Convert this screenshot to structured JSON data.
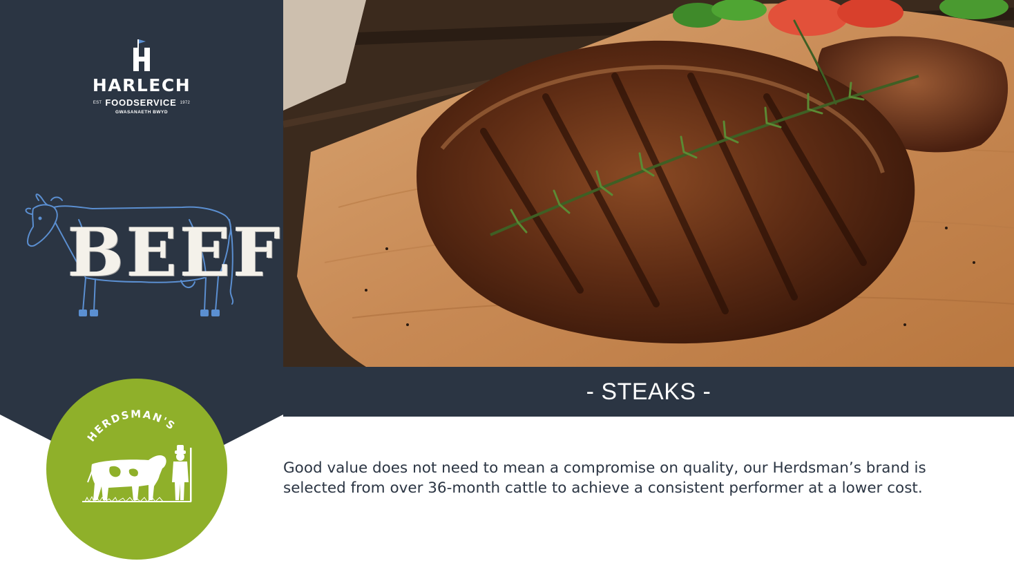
{
  "brand": {
    "name": "HARLECH",
    "est": "EST",
    "division": "FOODSERVICE",
    "year": "1972",
    "welsh": "GWASANAETH BWYD"
  },
  "category": {
    "word": "BEEF"
  },
  "badge": {
    "name": "HERDSMAN'S"
  },
  "hero": {
    "image": "grilled-ribeye-steak-photo"
  },
  "section": {
    "title": "- STEAKS -"
  },
  "description": "Good value does not need to mean a compromise on quality, our Herdsman’s brand is selected from over 36-month cattle to achieve a consistent performer at a lower cost.",
  "colors": {
    "navy": "#2b3543",
    "sky_blue": "#5b8fd1",
    "lime_green": "#8fb02a",
    "white": "#ffffff"
  }
}
